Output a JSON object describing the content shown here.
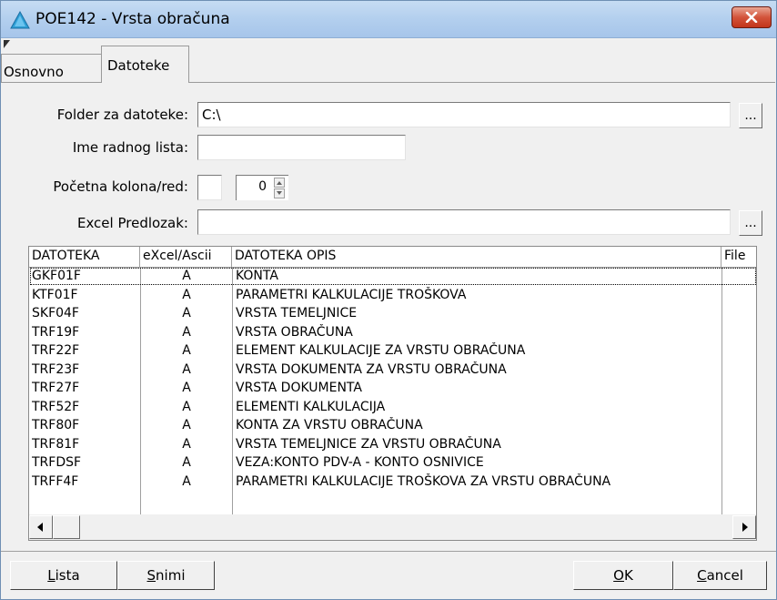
{
  "window": {
    "title": "POE142 - Vrsta obračuna"
  },
  "tabs": [
    {
      "label": "Osnovno",
      "active": false
    },
    {
      "label": "Datoteke",
      "active": true
    }
  ],
  "form": {
    "folder_label": "Folder za datoteke:",
    "folder_value": "C:\\",
    "sheet_label": "Ime radnog lista:",
    "sheet_value": "",
    "start_label": "Početna kolona/red:",
    "start_col_value": "",
    "start_row_value": "0",
    "template_label": "Excel Predlozak:",
    "template_value": "",
    "browse_label": "..."
  },
  "grid": {
    "columns": [
      "DATOTEKA",
      "eXcel/Ascii",
      "DATOTEKA OPIS",
      "File"
    ],
    "rows": [
      [
        "GKF01F",
        "A",
        "KONTA"
      ],
      [
        "KTF01F",
        "A",
        "PARAMETRI KALKULACIJE TROŠKOVA"
      ],
      [
        "SKF04F",
        "A",
        "VRSTA TEMELJNICE"
      ],
      [
        "TRF19F",
        "A",
        "VRSTA OBRAČUNA"
      ],
      [
        "TRF22F",
        "A",
        "ELEMENT KALKULACIJE ZA VRSTU OBRAČUNA"
      ],
      [
        "TRF23F",
        "A",
        "VRSTA DOKUMENTA ZA VRSTU OBRAČUNA"
      ],
      [
        "TRF27F",
        "A",
        "VRSTA DOKUMENTA"
      ],
      [
        "TRF52F",
        "A",
        "ELEMENTI KALKULACIJA"
      ],
      [
        "TRF80F",
        "A",
        "KONTA ZA VRSTU OBRAČUNA"
      ],
      [
        "TRF81F",
        "A",
        "VRSTA TEMELJNICE ZA VRSTU OBRAČUNA"
      ],
      [
        "TRFDSF",
        "A",
        "VEZA:KONTO PDV-A - KONTO OSNIVICE"
      ],
      [
        "TRFF4F",
        "A",
        "PARAMETRI KALKULACIJE TROŠKOVA ZA VRSTU OBRAČUNA"
      ]
    ]
  },
  "buttons": {
    "lista": {
      "pre": "",
      "key": "L",
      "post": "ista"
    },
    "snimi": {
      "pre": "",
      "key": "S",
      "post": "nimi"
    },
    "ok": {
      "pre": "",
      "key": "O",
      "post": "K"
    },
    "cancel": {
      "pre": "",
      "key": "C",
      "post": "ancel"
    }
  },
  "icons": {
    "app": "triangle-app-icon",
    "close": "close-icon",
    "spin_up": "arrow-up-icon",
    "spin_down": "arrow-down-icon",
    "scroll_left": "arrow-left-icon",
    "scroll_right": "arrow-right-icon"
  },
  "colors": {
    "titlebar": "#b3cfee",
    "close_button": "#c2351b",
    "app_icon": "#2f9fd6"
  }
}
